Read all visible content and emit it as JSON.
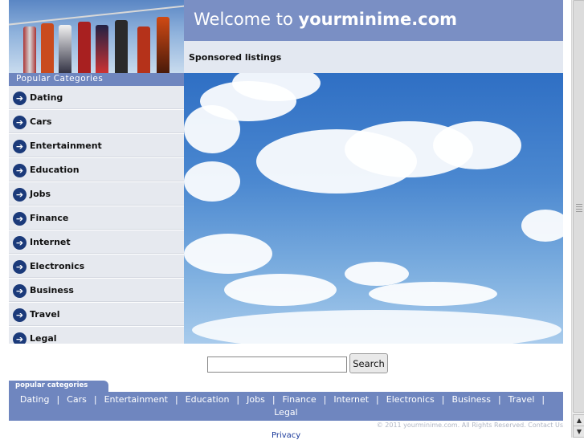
{
  "header": {
    "welcome_prefix": "Welcome to ",
    "site_name": "yourminime.com",
    "sponsored": "Sponsored listings"
  },
  "sidebar": {
    "title": "Popular Categories",
    "items": [
      {
        "label": "Dating"
      },
      {
        "label": "Cars"
      },
      {
        "label": "Entertainment"
      },
      {
        "label": "Education"
      },
      {
        "label": "Jobs"
      },
      {
        "label": "Finance"
      },
      {
        "label": "Internet"
      },
      {
        "label": "Electronics"
      },
      {
        "label": "Business"
      },
      {
        "label": "Travel"
      },
      {
        "label": "Legal"
      }
    ]
  },
  "search": {
    "value": "",
    "button_label": "Search"
  },
  "footer": {
    "tab_title": "popular categories",
    "links_row1": [
      "Dating",
      "Cars",
      "Entertainment",
      "Education",
      "Jobs",
      "Finance",
      "Internet",
      "Electronics",
      "Business",
      "Travel"
    ],
    "links_row2": [
      "Legal"
    ],
    "copyright": "© 2011 yourminime.com. All Rights Reserved.  Contact Us",
    "privacy": "Privacy"
  },
  "colors": {
    "header_blue": "#7a8fc4",
    "nav_bg": "#e6e9ef",
    "icon_navy": "#1b3a7a"
  },
  "icons": {
    "nav_bullet": "arrow-circle-icon"
  }
}
